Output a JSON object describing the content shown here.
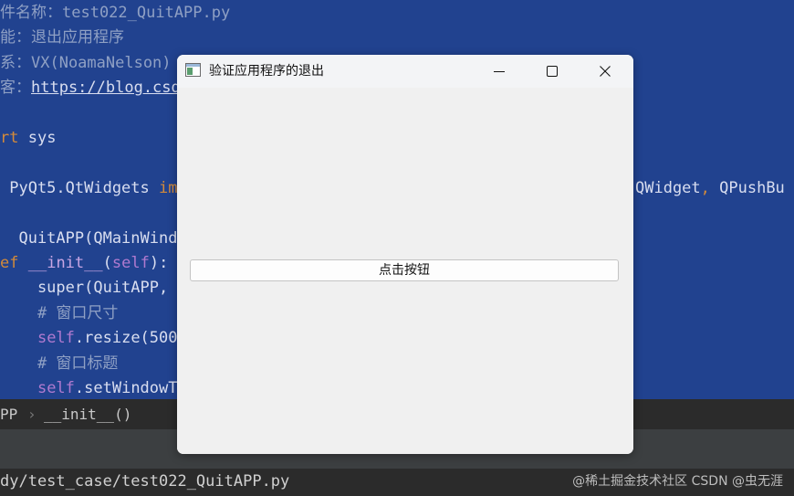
{
  "editor": {
    "lines": [
      {
        "parts": [
          {
            "t": "件名称：test022_QuitAPP.py",
            "c": "cm"
          }
        ]
      },
      {
        "parts": [
          {
            "t": "能：退出应用程序",
            "c": "cm"
          }
        ]
      },
      {
        "parts": [
          {
            "t": "系：VX(NoamaNelson)",
            "c": "cm"
          }
        ]
      },
      {
        "parts": [
          {
            "t": "客：",
            "c": "cm"
          },
          {
            "t": "https://blog.csd",
            "c": "link"
          }
        ]
      },
      {
        "parts": []
      },
      {
        "parts": [
          {
            "t": "rt",
            "c": "kw"
          },
          {
            "t": " sys",
            "c": ""
          }
        ]
      },
      {
        "parts": []
      },
      {
        "parts": [
          {
            "t": " PyQt5.QtWidgets ",
            "c": ""
          },
          {
            "t": "im",
            "c": "kw"
          }
        ]
      },
      {
        "parts": []
      },
      {
        "parts": [
          {
            "t": "  QuitAPP(QMainWind",
            "c": ""
          }
        ]
      },
      {
        "parts": [
          {
            "t": "ef",
            "c": "kw"
          },
          {
            "t": " ",
            "c": ""
          },
          {
            "t": "__init__",
            "c": "fn"
          },
          {
            "t": "(",
            "c": ""
          },
          {
            "t": "self",
            "c": "self"
          },
          {
            "t": "):",
            "c": ""
          }
        ]
      },
      {
        "parts": [
          {
            "t": "    super(QuitAPP,",
            "c": ""
          }
        ]
      },
      {
        "parts": [
          {
            "t": "    # 窗口尺寸",
            "c": "cm"
          }
        ]
      },
      {
        "parts": [
          {
            "t": "    ",
            "c": ""
          },
          {
            "t": "self",
            "c": "self"
          },
          {
            "t": ".resize(500",
            "c": ""
          }
        ]
      },
      {
        "parts": [
          {
            "t": "    # 窗口标题",
            "c": "cm"
          }
        ]
      },
      {
        "parts": [
          {
            "t": "    ",
            "c": ""
          },
          {
            "t": "self",
            "c": "self"
          },
          {
            "t": ".setWindowT",
            "c": ""
          }
        ]
      }
    ],
    "right_fragment": [
      {
        "t": "QWidget",
        "c": ""
      },
      {
        "t": ", ",
        "c": "kw"
      },
      {
        "t": "QPushBu",
        "c": ""
      }
    ]
  },
  "breadcrumb": {
    "class_name": "PP",
    "separator": "›",
    "method_name": "__init__()"
  },
  "statusbar": {
    "path": "dy/test_case/test022_QuitAPP.py",
    "watermark": "@稀土掘金技术社区 CSDN @虫无涯"
  },
  "window": {
    "title": "验证应用程序的退出",
    "minimize_glyph": "—",
    "maximize_glyph": "☐",
    "close_glyph": "✕",
    "push_button_label": "点击按钮"
  },
  "colors": {
    "editor_bg": "#21428f",
    "window_bg": "#f0f0f0",
    "keyword": "#d38a3a",
    "self": "#b07acf"
  }
}
